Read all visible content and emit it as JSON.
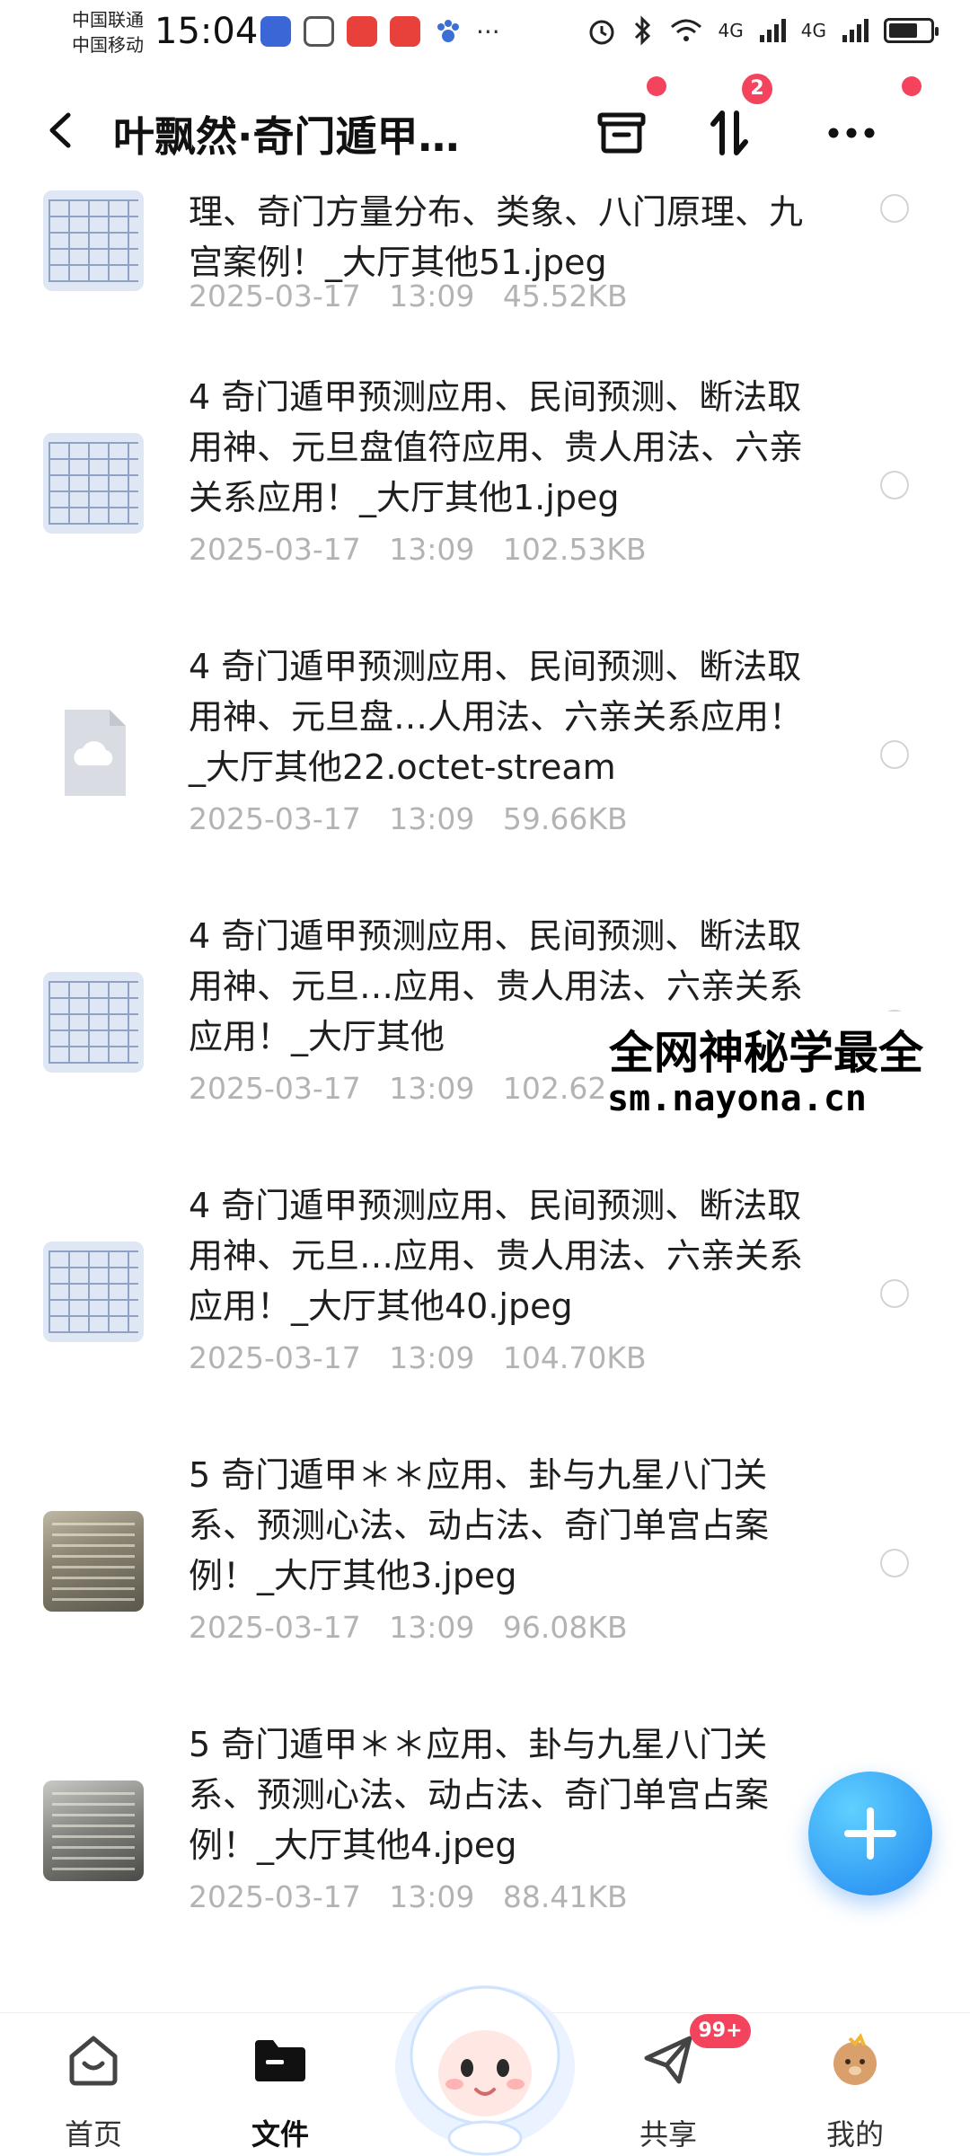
{
  "status_bar": {
    "carrier_1": "中国联通",
    "carrier_2": "中国移动",
    "time": "15:04",
    "more": "···",
    "network_1": "4G",
    "network_2": "4G",
    "battery_level": 0.7
  },
  "header": {
    "title": "叶飘然·奇门遁甲…",
    "transfer_badge": "2",
    "more": "···"
  },
  "files": [
    {
      "name": "理、奇门方量分布、类象、八门原理、九宫案例！_大厅其他51.jpeg",
      "date": "2025-03-17",
      "time": "13:09",
      "size": "45.52KB",
      "thumb": "table"
    },
    {
      "name": "4 奇门遁甲预测应用、民间预测、断法取用神、元旦盘值符应用、贵人用法、六亲关系应用！_大厅其他1.jpeg",
      "date": "2025-03-17",
      "time": "13:09",
      "size": "102.53KB",
      "thumb": "table"
    },
    {
      "name": "4 奇门遁甲预测应用、民间预测、断法取用神、元旦盘…人用法、六亲关系应用！_大厅其他22.octet-stream",
      "date": "2025-03-17",
      "time": "13:09",
      "size": "59.66KB",
      "thumb": "file"
    },
    {
      "name": "4 奇门遁甲预测应用、民间预测、断法取用神、元旦…应用、贵人用法、六亲关系应用！_大厅其他",
      "date": "2025-03-17",
      "time": "13:09",
      "size": "102.62KB",
      "thumb": "table"
    },
    {
      "name": "4 奇门遁甲预测应用、民间预测、断法取用神、元旦…应用、贵人用法、六亲关系应用！_大厅其他40.jpeg",
      "date": "2025-03-17",
      "time": "13:09",
      "size": "104.70KB",
      "thumb": "table"
    },
    {
      "name": "5 奇门遁甲＊＊应用、卦与九星八门关系、预测心法、动占法、奇门单宫占案例！_大厅其他3.jpeg",
      "date": "2025-03-17",
      "time": "13:09",
      "size": "96.08KB",
      "thumb": "photo"
    },
    {
      "name": "5 奇门遁甲＊＊应用、卦与九星八门关系、预测心法、动占法、奇门单宫占案例！_大厅其他4.jpeg",
      "date": "2025-03-17",
      "time": "13:09",
      "size": "88.41KB",
      "thumb": "photo2"
    }
  ],
  "watermark": {
    "line1": "全网神秘学最全",
    "line2": "sm.nayona.cn"
  },
  "bottom_nav": {
    "home": "首页",
    "files": "文件",
    "share": "共享",
    "share_badge": "99+",
    "mine": "我的"
  },
  "colors": {
    "accent": "#1f86f0",
    "badge": "#f4435c",
    "meta_text": "#b3b3b3"
  }
}
